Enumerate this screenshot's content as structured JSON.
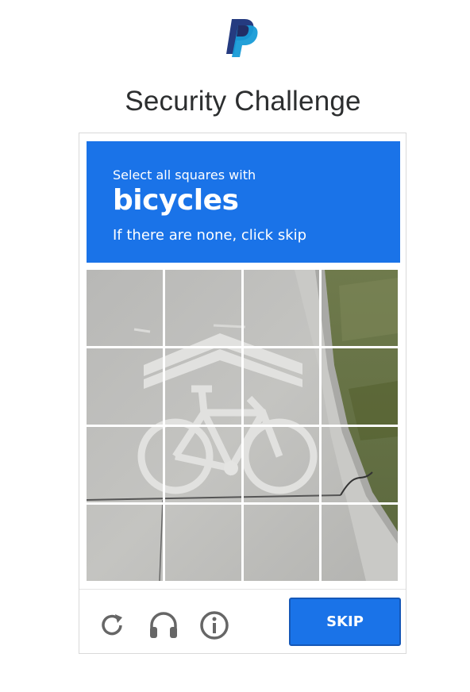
{
  "page": {
    "title": "Security Challenge"
  },
  "brand": {
    "logo_icon": "paypal-logo-icon",
    "colors": {
      "dark_blue": "#253b80",
      "light_blue": "#179bd7"
    }
  },
  "challenge": {
    "instruction": "Select all squares with",
    "target": "bicycles",
    "hint": "If there are none, click skip",
    "banner_color": "#1a73e8",
    "grid_rows": 4,
    "grid_cols": 4
  },
  "controls": {
    "reload_icon": "reload-icon",
    "audio_icon": "headphones-icon",
    "info_icon": "info-icon",
    "skip_label": "SKIP"
  }
}
